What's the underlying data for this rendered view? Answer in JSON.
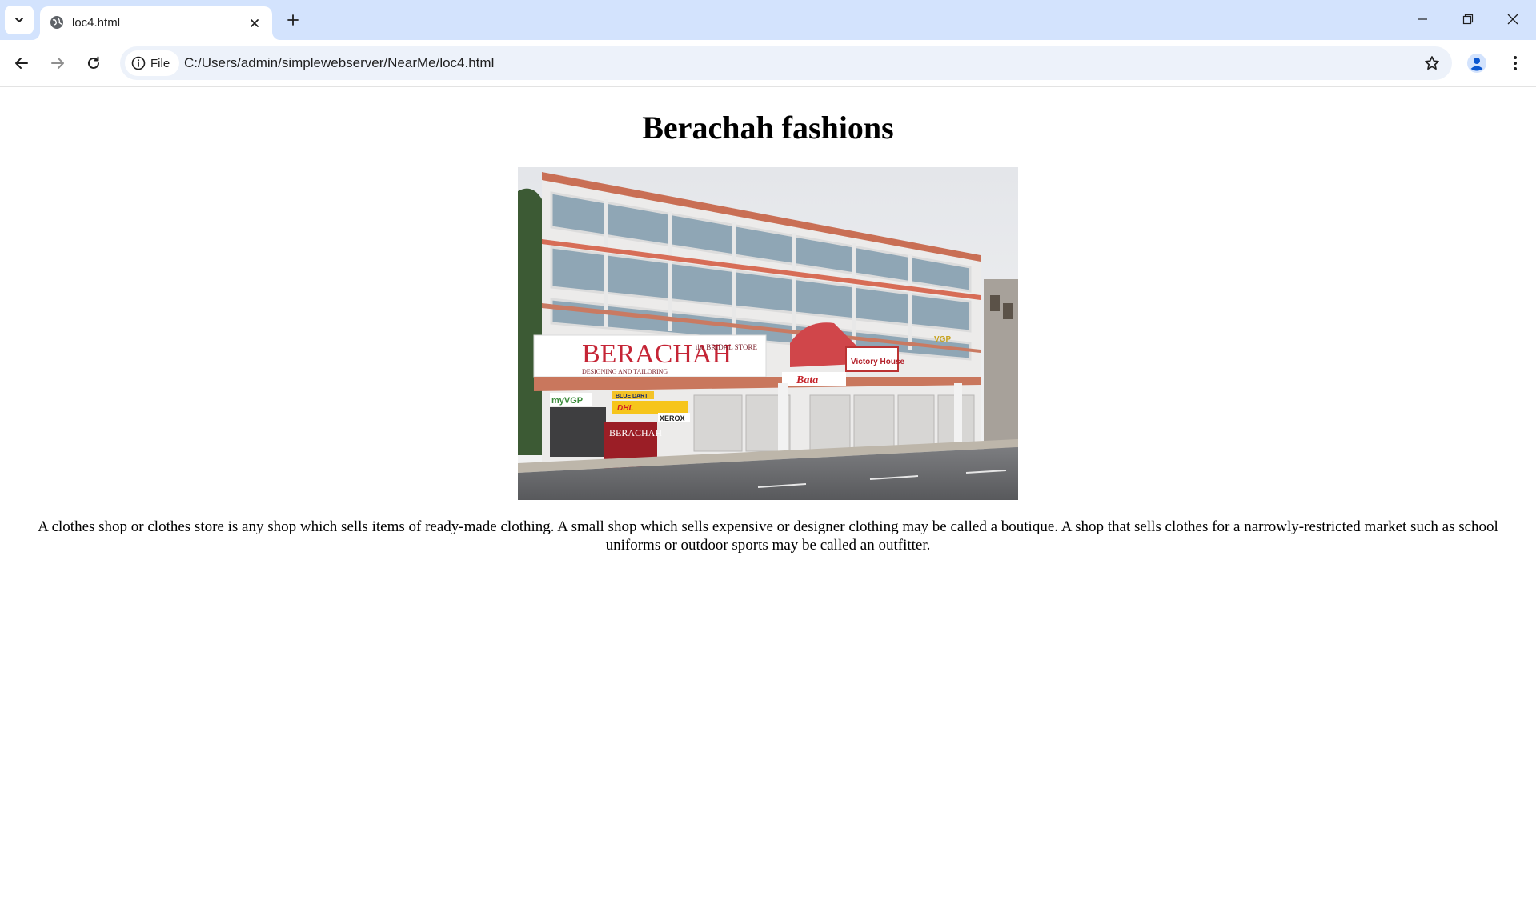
{
  "browser": {
    "tab": {
      "title": "loc4.html"
    },
    "omnibox": {
      "chip_label": "File",
      "url": "C:/Users/admin/simplewebserver/NearMe/loc4.html"
    },
    "icons": {
      "tab_search": "chevron-down-icon",
      "favicon": "globe-icon",
      "tab_close": "close-icon",
      "new_tab": "plus-icon",
      "minimize": "minimize-icon",
      "restore": "restore-icon",
      "close_window": "close-icon",
      "back": "back-arrow-icon",
      "forward": "forward-arrow-icon",
      "reload": "reload-icon",
      "site_info": "info-icon",
      "bookmark": "star-icon",
      "profile": "person-icon",
      "menu": "kebab-menu-icon"
    },
    "colors": {
      "tabstrip": "#d3e3fd",
      "omnibox": "#edf2fa",
      "profile_accent": "#0b57d0"
    }
  },
  "page": {
    "title": "Berachah fashions",
    "image": {
      "sign_main": "BERACHAH",
      "sign_sub": "DESIGNING AND TAILORING",
      "sign_bridal": "the BRIDAL STORE",
      "sign_victory": "Victory House",
      "sign_bata": "Bata",
      "sign_myvgp": "myVGP",
      "sign_bluedart": "BLUE DART",
      "sign_dhl": "DHL",
      "sign_xerox": "XEROX",
      "sign_vgp": "VGP"
    },
    "description": "A clothes shop or clothes store is any shop which sells items of ready-made clothing. A small shop which sells expensive or designer clothing may be called a boutique. A shop that sells clothes for a narrowly-restricted market such as school uniforms or outdoor sports may be called an outfitter."
  }
}
